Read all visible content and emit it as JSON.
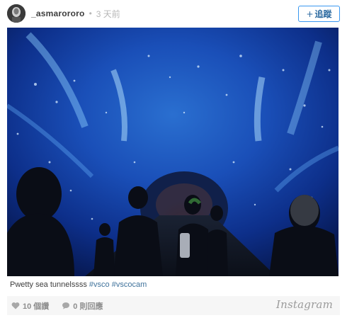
{
  "header": {
    "username": "_asmarororo",
    "separator": "•",
    "time_ago": "3 天前",
    "follow_plus": "+",
    "follow_label": "追蹤"
  },
  "post": {
    "caption_text": "Pwetty sea tunnelssss",
    "hashtags": [
      "#vsco",
      "#vscocam"
    ]
  },
  "footer": {
    "likes": "10 個讚",
    "comments": "0 則回應",
    "brand": "Instagram"
  },
  "icons": {
    "heart": "heart-icon",
    "comment": "comment-icon"
  },
  "colors": {
    "follow_border": "#3897f0",
    "hashtag": "#3f729b",
    "muted": "#8e8e8e"
  }
}
